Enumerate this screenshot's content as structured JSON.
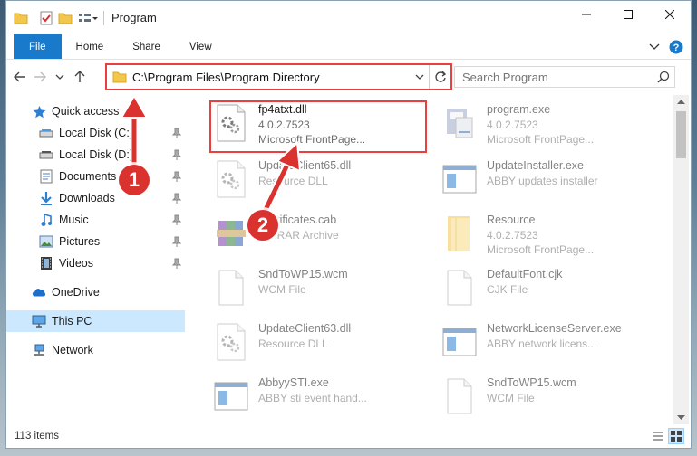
{
  "window": {
    "title": "Program"
  },
  "ribbon": {
    "tabs": [
      "File",
      "Home",
      "Share",
      "View"
    ]
  },
  "address": {
    "path": "C:\\Program Files\\Program Directory"
  },
  "search": {
    "placeholder": "Search Program"
  },
  "sidebar": {
    "quick_access": "Quick access",
    "items": [
      {
        "label": "Local Disk (C:)",
        "icon": "drive-icon"
      },
      {
        "label": "Local Disk (D:)",
        "icon": "drive-icon"
      },
      {
        "label": "Documents",
        "icon": "documents-icon"
      },
      {
        "label": "Downloads",
        "icon": "downloads-icon"
      },
      {
        "label": "Music",
        "icon": "music-icon"
      },
      {
        "label": "Pictures",
        "icon": "pictures-icon"
      },
      {
        "label": "Videos",
        "icon": "videos-icon"
      }
    ],
    "onedrive": "OneDrive",
    "this_pc": "This PC",
    "network": "Network"
  },
  "files": [
    {
      "name": "fp4atxt.dll",
      "line1": "4.0.2.7523",
      "line2": "Microsoft FrontPage...",
      "icon": "dll-gear-icon"
    },
    {
      "name": "program.exe",
      "line1": "4.0.2.7523",
      "line2": "Microsoft FrontPage...",
      "icon": "exe-icon"
    },
    {
      "name": "UpdateClient65.dll",
      "line1": "Resource DLL",
      "line2": "",
      "icon": "dll-gear-icon"
    },
    {
      "name": "UpdateInstaller.exe",
      "line1": "ABBY updates installer",
      "line2": "",
      "icon": "window-app-icon"
    },
    {
      "name": "Certificates.cab",
      "line1": "WinRAR Archive",
      "line2": "",
      "icon": "winrar-icon"
    },
    {
      "name": "Resource",
      "line1": "4.0.2.7523",
      "line2": "Microsoft FrontPage...",
      "icon": "folder-icon"
    },
    {
      "name": "SndToWP15.wcm",
      "line1": "WCM File",
      "line2": "",
      "icon": "blank-file-icon"
    },
    {
      "name": "DefaultFont.cjk",
      "line1": "CJK File",
      "line2": "",
      "icon": "blank-file-icon"
    },
    {
      "name": "UpdateClient63.dll",
      "line1": "Resource DLL",
      "line2": "",
      "icon": "dll-gear-icon"
    },
    {
      "name": "NetworkLicenseServer.exe",
      "line1": "ABBY network licens...",
      "line2": "",
      "icon": "window-app-icon"
    },
    {
      "name": "AbbyySTI.exe",
      "line1": "ABBY sti event hand...",
      "line2": "",
      "icon": "window-app-icon"
    },
    {
      "name": "SndToWP15.wcm",
      "line1": "WCM File",
      "line2": "",
      "icon": "blank-file-icon"
    }
  ],
  "status": {
    "count": "113 items"
  },
  "callouts": {
    "one": "1",
    "two": "2"
  },
  "colors": {
    "accent": "#1979ca",
    "highlight": "#e8403f",
    "selected": "#cce8ff"
  }
}
